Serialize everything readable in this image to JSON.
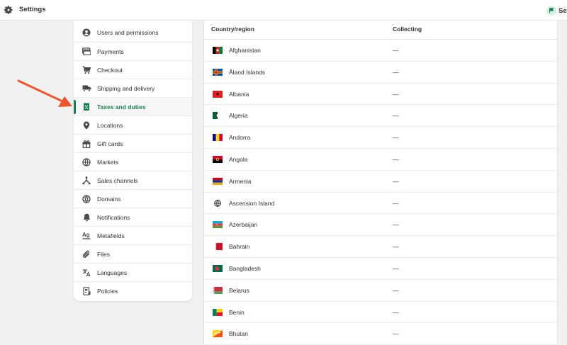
{
  "topbar": {
    "title": "Settings",
    "setup_label": "Set"
  },
  "sidebar": {
    "items": [
      {
        "label": "Users and permissions",
        "icon": "user-icon"
      },
      {
        "label": "Payments",
        "icon": "payments-icon"
      },
      {
        "label": "Checkout",
        "icon": "cart-icon"
      },
      {
        "label": "Shipping and delivery",
        "icon": "truck-icon"
      },
      {
        "label": "Taxes and duties",
        "icon": "tax-icon",
        "active": true
      },
      {
        "label": "Locations",
        "icon": "location-pin-icon"
      },
      {
        "label": "Gift cards",
        "icon": "gift-icon"
      },
      {
        "label": "Markets",
        "icon": "globe-icon"
      },
      {
        "label": "Sales channels",
        "icon": "sales-channels-icon"
      },
      {
        "label": "Domains",
        "icon": "domains-globe-icon"
      },
      {
        "label": "Notifications",
        "icon": "bell-icon"
      },
      {
        "label": "Metafields",
        "icon": "metafields-icon"
      },
      {
        "label": "Files",
        "icon": "paperclip-icon"
      },
      {
        "label": "Languages",
        "icon": "translate-icon"
      },
      {
        "label": "Policies",
        "icon": "policy-document-icon"
      }
    ]
  },
  "table": {
    "headers": {
      "country": "Country/region",
      "collecting": "Collecting"
    },
    "rows": [
      {
        "country": "Afghanistan",
        "collecting": "—"
      },
      {
        "country": "Åland Islands",
        "collecting": "—"
      },
      {
        "country": "Albania",
        "collecting": "—"
      },
      {
        "country": "Algeria",
        "collecting": "—"
      },
      {
        "country": "Andorra",
        "collecting": "—"
      },
      {
        "country": "Angola",
        "collecting": "—"
      },
      {
        "country": "Armenia",
        "collecting": "—"
      },
      {
        "country": "Ascension Island",
        "collecting": "—"
      },
      {
        "country": "Azerbaijan",
        "collecting": "—"
      },
      {
        "country": "Bahrain",
        "collecting": "—"
      },
      {
        "country": "Bangladesh",
        "collecting": "—"
      },
      {
        "country": "Belarus",
        "collecting": "—"
      },
      {
        "country": "Benin",
        "collecting": "—"
      },
      {
        "country": "Bhutan",
        "collecting": "—"
      }
    ]
  },
  "colors": {
    "accent": "#1a7f54",
    "arrow": "#f2552c"
  }
}
